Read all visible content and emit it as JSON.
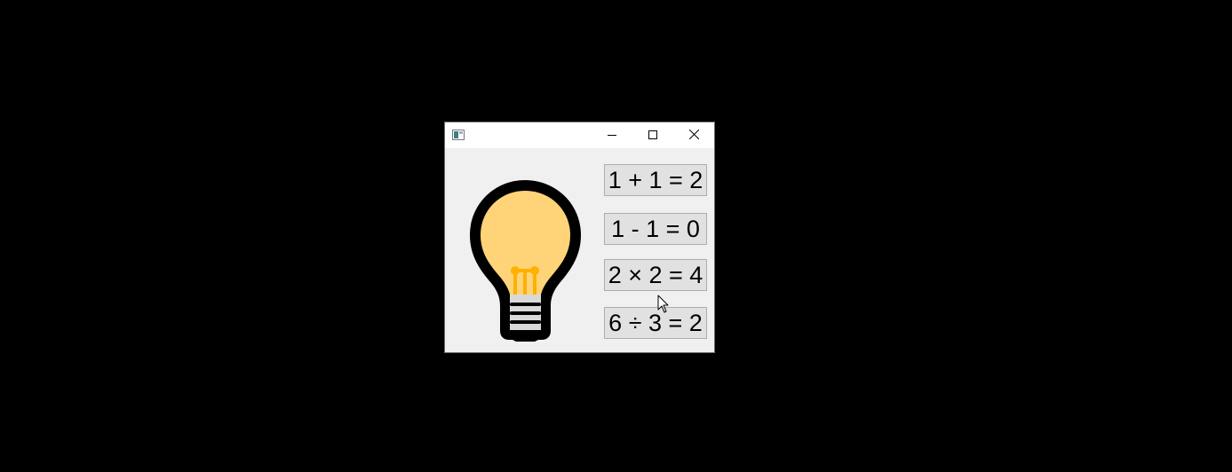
{
  "window": {
    "title": "",
    "controls": {
      "minimize": "minimize",
      "maximize": "maximize",
      "close": "close"
    }
  },
  "buttons": [
    {
      "label": "1 + 1 = 2"
    },
    {
      "label": "1 - 1 = 0"
    },
    {
      "label": "2 × 2 = 4"
    },
    {
      "label": "6 ÷ 3 = 2"
    }
  ],
  "image": {
    "icon": "lightbulb-icon"
  },
  "colors": {
    "desktop": "#000000",
    "window_bg": "#f0f0f0",
    "titlebar_bg": "#ffffff",
    "button_bg": "#e1e1e1",
    "button_border": "#adadad",
    "bulb_glass": "#ffd479",
    "bulb_filament": "#ffb000",
    "bulb_outline": "#000000",
    "bulb_base": "#d9d9d9"
  }
}
